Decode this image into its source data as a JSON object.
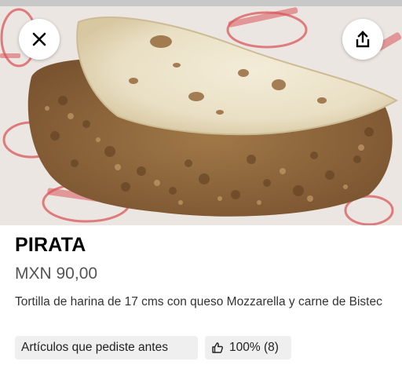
{
  "product": {
    "name": "PIRATA",
    "price": "MXN 90,00",
    "description": "Tortilla de harina de 17 cms con queso Mozzarella y carne de Bistec"
  },
  "tags": {
    "previous_orders": "Artículos que pediste antes",
    "rating": "100% (8)"
  },
  "icons": {
    "close": "close-icon",
    "share": "share-icon",
    "thumbs_up": "thumbs-up-icon"
  },
  "colors": {
    "price_text": "#545454",
    "chip_bg": "#efefef",
    "paper_print": "#d9575a"
  }
}
